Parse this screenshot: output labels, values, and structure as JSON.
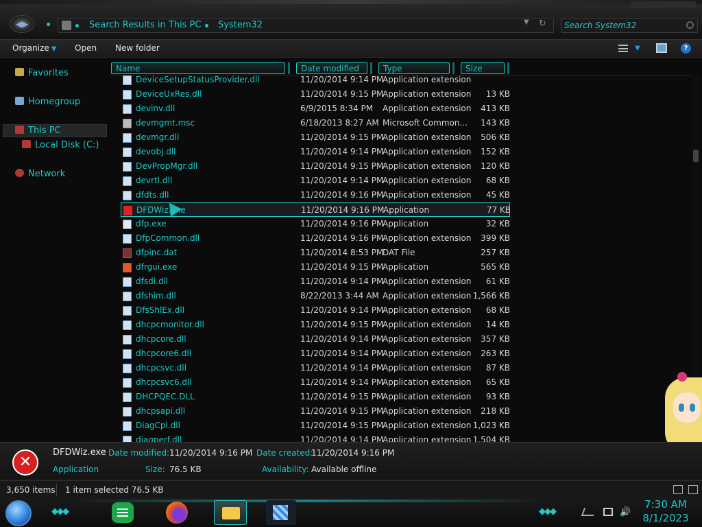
{
  "address": {
    "crumbs": [
      "Search Results in This PC",
      "System32"
    ]
  },
  "search": {
    "placeholder": "Search System32"
  },
  "toolbar": {
    "organize": "Organize",
    "open": "Open",
    "new_folder": "New folder"
  },
  "nav": {
    "favorites": "Favorites",
    "homegroup": "Homegroup",
    "this_pc": "This PC",
    "local_disk": "Local Disk (C:)",
    "network": "Network"
  },
  "columns": {
    "name": "Name",
    "date": "Date modified",
    "type": "Type",
    "size": "Size"
  },
  "files": [
    {
      "name": "DeviceSetupStatusProvider.dll",
      "date": "11/20/2014 9:14 PM",
      "type": "Application extension",
      "size": "",
      "icon": "dll",
      "partial": true
    },
    {
      "name": "DeviceUxRes.dll",
      "date": "11/20/2014 9:15 PM",
      "type": "Application extension",
      "size": "13 KB",
      "icon": "dll"
    },
    {
      "name": "devinv.dll",
      "date": "6/9/2015 8:34 PM",
      "type": "Application extension",
      "size": "413 KB",
      "icon": "dll"
    },
    {
      "name": "devmgmt.msc",
      "date": "6/18/2013 8:27 AM",
      "type": "Microsoft Common...",
      "size": "143 KB",
      "icon": "msc"
    },
    {
      "name": "devmgr.dll",
      "date": "11/20/2014 9:15 PM",
      "type": "Application extension",
      "size": "506 KB",
      "icon": "dll"
    },
    {
      "name": "devobj.dll",
      "date": "11/20/2014 9:14 PM",
      "type": "Application extension",
      "size": "152 KB",
      "icon": "dll"
    },
    {
      "name": "DevPropMgr.dll",
      "date": "11/20/2014 9:15 PM",
      "type": "Application extension",
      "size": "120 KB",
      "icon": "dll"
    },
    {
      "name": "devrtl.dll",
      "date": "11/20/2014 9:14 PM",
      "type": "Application extension",
      "size": "68 KB",
      "icon": "dll"
    },
    {
      "name": "dfdts.dll",
      "date": "11/20/2014 9:16 PM",
      "type": "Application extension",
      "size": "45 KB",
      "icon": "dll"
    },
    {
      "name": "DFDWiz.exe",
      "date": "11/20/2014 9:16 PM",
      "type": "Application",
      "size": "77 KB",
      "icon": "exe-err",
      "selected": true
    },
    {
      "name": "dfp.exe",
      "date": "11/20/2014 9:16 PM",
      "type": "Application",
      "size": "32 KB",
      "icon": "exe"
    },
    {
      "name": "DfpCommon.dll",
      "date": "11/20/2014 9:16 PM",
      "type": "Application extension",
      "size": "399 KB",
      "icon": "dll"
    },
    {
      "name": "dfpinc.dat",
      "date": "11/20/2014 8:53 PM",
      "type": "DAT File",
      "size": "257 KB",
      "icon": "dat"
    },
    {
      "name": "dfrgui.exe",
      "date": "11/20/2014 9:15 PM",
      "type": "Application",
      "size": "565 KB",
      "icon": "gui"
    },
    {
      "name": "dfsdi.dll",
      "date": "11/20/2014 9:14 PM",
      "type": "Application extension",
      "size": "61 KB",
      "icon": "dll"
    },
    {
      "name": "dfshim.dll",
      "date": "8/22/2013 3:44 AM",
      "type": "Application extension",
      "size": "1,566 KB",
      "icon": "dll"
    },
    {
      "name": "DfsShlEx.dll",
      "date": "11/20/2014 9:14 PM",
      "type": "Application extension",
      "size": "68 KB",
      "icon": "dll"
    },
    {
      "name": "dhcpcmonitor.dll",
      "date": "11/20/2014 9:15 PM",
      "type": "Application extension",
      "size": "14 KB",
      "icon": "dll"
    },
    {
      "name": "dhcpcore.dll",
      "date": "11/20/2014 9:14 PM",
      "type": "Application extension",
      "size": "357 KB",
      "icon": "dll"
    },
    {
      "name": "dhcpcore6.dll",
      "date": "11/20/2014 9:14 PM",
      "type": "Application extension",
      "size": "263 KB",
      "icon": "dll"
    },
    {
      "name": "dhcpcsvc.dll",
      "date": "11/20/2014 9:14 PM",
      "type": "Application extension",
      "size": "87 KB",
      "icon": "dll"
    },
    {
      "name": "dhcpcsvc6.dll",
      "date": "11/20/2014 9:14 PM",
      "type": "Application extension",
      "size": "65 KB",
      "icon": "dll"
    },
    {
      "name": "DHCPQEC.DLL",
      "date": "11/20/2014 9:15 PM",
      "type": "Application extension",
      "size": "93 KB",
      "icon": "dll"
    },
    {
      "name": "dhcpsapi.dll",
      "date": "11/20/2014 9:15 PM",
      "type": "Application extension",
      "size": "218 KB",
      "icon": "dll"
    },
    {
      "name": "DiagCpl.dll",
      "date": "11/20/2014 9:15 PM",
      "type": "Application extension",
      "size": "1,023 KB",
      "icon": "dll"
    },
    {
      "name": "diagperf.dll",
      "date": "11/20/2014 9:14 PM",
      "type": "Application extension",
      "size": "1,504 KB",
      "icon": "dll"
    }
  ],
  "details": {
    "name": "DFDWiz.exe",
    "type": "Application",
    "date_modified_label": "Date modified:",
    "date_modified": "11/20/2014 9:16 PM",
    "size_label": "Size:",
    "size": "76.5 KB",
    "date_created_label": "Date created:",
    "date_created": "11/20/2014 9:16 PM",
    "availability_label": "Availability:",
    "availability": "Available offline"
  },
  "status": {
    "items": "3,650 items",
    "selected": "1 item selected  76.5 KB"
  },
  "clock": {
    "time": "7:30 AM",
    "date": "8/1/2023"
  },
  "colors": {
    "accent": "#1ec8c8",
    "background": "#0b0b0b",
    "error": "#d72020"
  }
}
